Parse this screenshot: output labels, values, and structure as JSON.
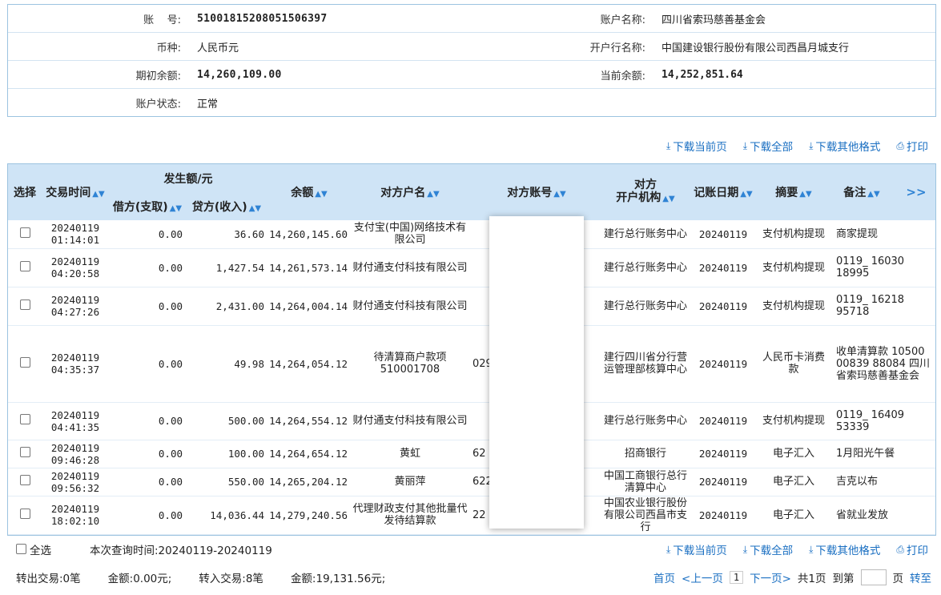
{
  "account": {
    "acct_no_label": "账    号:",
    "acct_no": "51001815208051506397",
    "acct_name_label": "账户名称:",
    "acct_name": "四川省索玛慈善基金会",
    "currency_label": "币种:",
    "currency": "人民币元",
    "bank_label": "开户行名称:",
    "bank": "中国建设银行股份有限公司西昌月城支行",
    "open_bal_label": "期初余额:",
    "open_bal": "14,260,109.00",
    "cur_bal_label": "当前余额:",
    "cur_bal": "14,252,851.64",
    "status_label": "账户状态:",
    "status": "正常"
  },
  "toolbar": {
    "download_page": "下载当前页",
    "download_all": "下载全部",
    "download_other": "下载其他格式",
    "print": "打印"
  },
  "table": {
    "headers": {
      "select": "选择",
      "time": "交易时间",
      "amount_group": "发生额/元",
      "debit": "借方(支取)",
      "credit": "贷方(收入)",
      "balance": "余额",
      "party_name": "对方户名",
      "party_acct": "对方账号",
      "party_bank": "对方\n开户机构",
      "post_date": "记账日期",
      "summary": "摘要",
      "remark": "备注",
      "expand": ">>"
    },
    "rows": [
      {
        "date": "20240119",
        "time": "01:14:01",
        "debit": "0.00",
        "credit": "36.60",
        "balance": "14,260,145.60",
        "name": "支付宝(中国)网络技术有限公司",
        "acct": "",
        "bank": "建行总行账务中心",
        "post": "20240119",
        "summary": "支付机构提现",
        "remark": "商家提现"
      },
      {
        "date": "20240119",
        "time": "04:20:58",
        "debit": "0.00",
        "credit": "1,427.54",
        "balance": "14,261,573.14",
        "name": "财付通支付科技有限公司",
        "acct": "",
        "bank": "建行总行账务中心",
        "post": "20240119",
        "summary": "支付机构提现",
        "remark": "0119_ 16030 18995"
      },
      {
        "date": "20240119",
        "time": "04:27:26",
        "debit": "0.00",
        "credit": "2,431.00",
        "balance": "14,264,004.14",
        "name": "财付通支付科技有限公司",
        "acct": "",
        "bank": "建行总行账务中心",
        "post": "20240119",
        "summary": "支付机构提现",
        "remark": "0119_ 16218 95718"
      },
      {
        "date": "20240119",
        "time": "04:35:37",
        "debit": "0.00",
        "credit": "49.98",
        "balance": "14,264,054.12",
        "name": "待清算商户款项510001708",
        "acct": "029",
        "bank": "建行四川省分行营运管理部核算中心",
        "post": "20240119",
        "summary": "人民币卡消费款",
        "remark": "收单清算款 10500 00839 88084 四川省索玛慈善基金会"
      },
      {
        "date": "20240119",
        "time": "04:41:35",
        "debit": "0.00",
        "credit": "500.00",
        "balance": "14,264,554.12",
        "name": "财付通支付科技有限公司",
        "acct": "",
        "bank": "建行总行账务中心",
        "post": "20240119",
        "summary": "支付机构提现",
        "remark": "0119_ 16409 53339"
      },
      {
        "date": "20240119",
        "time": "09:46:28",
        "debit": "0.00",
        "credit": "100.00",
        "balance": "14,264,654.12",
        "name": "黄虹",
        "acct": "62",
        "bank": "招商银行",
        "post": "20240119",
        "summary": "电子汇入",
        "remark": "1月阳光午餐"
      },
      {
        "date": "20240119",
        "time": "09:56:32",
        "debit": "0.00",
        "credit": "550.00",
        "balance": "14,265,204.12",
        "name": "黄丽萍",
        "acct": "622",
        "bank": "中国工商银行总行清算中心",
        "post": "20240119",
        "summary": "电子汇入",
        "remark": "吉克以布"
      },
      {
        "date": "20240119",
        "time": "18:02:10",
        "debit": "0.00",
        "credit": "14,036.44",
        "balance": "14,279,240.56",
        "name": "代理财政支付其他批量代发待结算款",
        "acct": "22",
        "bank": "中国农业银行股份有限公司西昌市支行",
        "post": "20240119",
        "summary": "电子汇入",
        "remark": "省就业发放"
      }
    ]
  },
  "footer": {
    "select_all": "全选",
    "query_time": "本次查询时间:20240119-20240119",
    "out_count": "转出交易:0笔",
    "out_amount": "金额:0.00元;",
    "in_count": "转入交易:8笔",
    "in_amount": "金额:19,131.56元;",
    "first": "首页",
    "prev": "<上一页",
    "page": "1",
    "next": "下一页>",
    "total": "共1页",
    "goto": "到第",
    "page_unit": "页",
    "jump": "转至"
  }
}
